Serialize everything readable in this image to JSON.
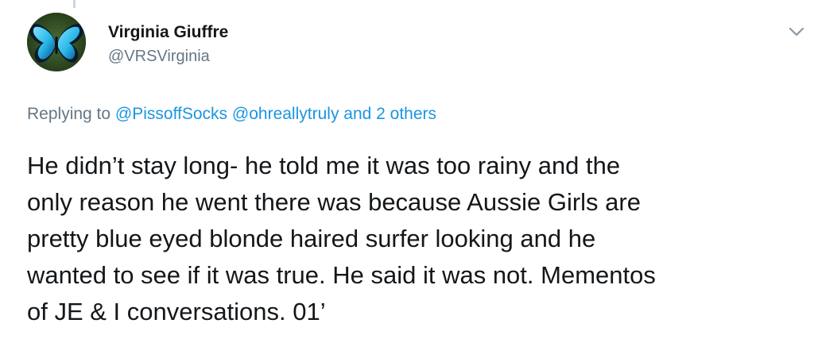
{
  "author": {
    "display_name": "Virginia Giuffre",
    "handle": "@VRSVirginia",
    "avatar": "blue-morpho-butterfly-icon"
  },
  "menu": {
    "icon": "chevron-down-icon"
  },
  "reply": {
    "prefix": "Replying to",
    "mentions": [
      "@PissoffSocks",
      "@ohreallytruly"
    ],
    "others": "and 2 others"
  },
  "tweet": {
    "lines": [
      "He didn’t stay long- he told me it was too rainy and the",
      "only reason he went there was because Aussie Girls are",
      "pretty blue eyed blonde haired surfer looking and he",
      "wanted to see if it was true. He said it was not. Mementos",
      "of JE & I conversations. 01’"
    ]
  },
  "colors": {
    "text": "#14171a",
    "secondary": "#657786",
    "link": "#1b95e0",
    "butterfly": "#29b6e8"
  }
}
